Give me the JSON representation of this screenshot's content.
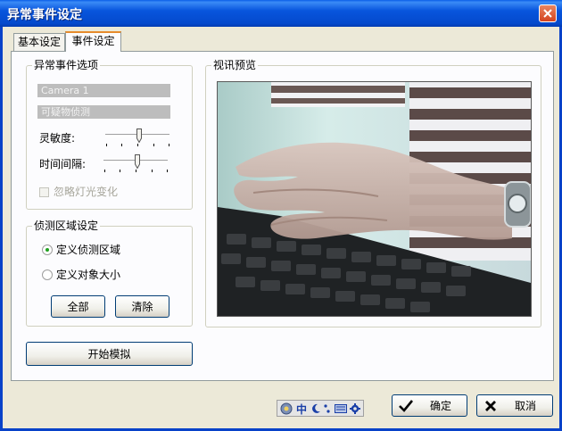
{
  "window": {
    "title": "异常事件设定"
  },
  "tabs": [
    {
      "label": "基本设定"
    },
    {
      "label": "事件设定"
    }
  ],
  "event_options": {
    "title": "异常事件选项",
    "camera_value": "Camera 1",
    "event_type_value": "可疑物侦测",
    "sensitivity_label": "灵敏度:",
    "interval_label": "时间间隔:",
    "ignore_light_label": "忽略灯光变化"
  },
  "detection_area": {
    "title": "侦测区域设定",
    "define_area_label": "定义侦测区域",
    "define_size_label": "定义对象大小",
    "all_button": "全部",
    "clear_button": "清除"
  },
  "simulate_button": "开始模拟",
  "preview": {
    "title": "视讯预览"
  },
  "footer": {
    "ok_label": "确定",
    "cancel_label": "取消"
  },
  "ime_bar": {
    "mode": "中"
  }
}
